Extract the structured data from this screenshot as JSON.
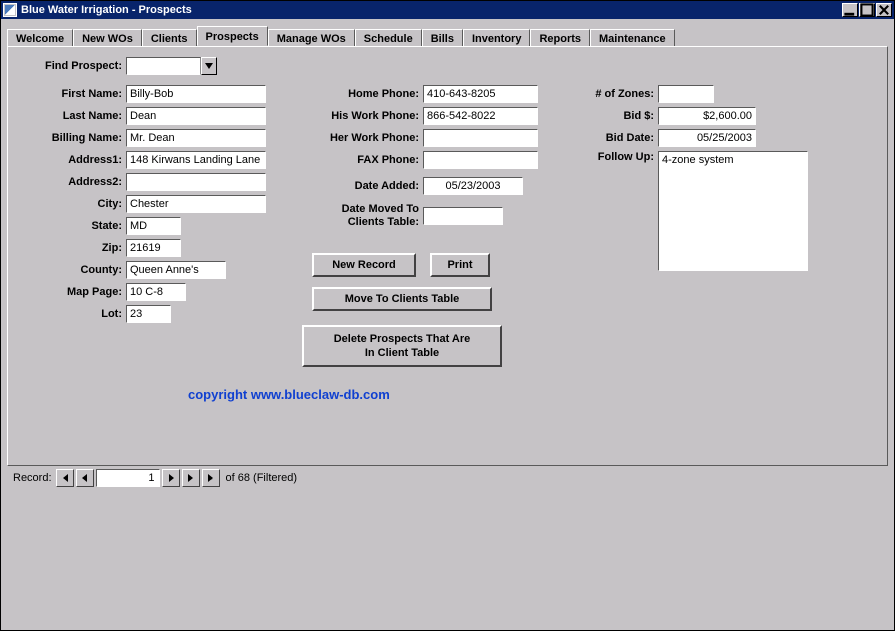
{
  "window": {
    "title": "Blue Water Irrigation - Prospects"
  },
  "tabs": {
    "welcome": "Welcome",
    "new_wos": "New WOs",
    "clients": "Clients",
    "prospects": "Prospects",
    "manage_wos": "Manage WOs",
    "schedule": "Schedule",
    "bills": "Bills",
    "inventory": "Inventory",
    "reports": "Reports",
    "maintenance": "Maintenance"
  },
  "labels": {
    "find_prospect": "Find Prospect:",
    "first_name": "First Name:",
    "last_name": "Last Name:",
    "billing_name": "Billing Name:",
    "address1": "Address1:",
    "address2": "Address2:",
    "city": "City:",
    "state": "State:",
    "zip": "Zip:",
    "county": "County:",
    "map_page": "Map Page:",
    "lot": "Lot:",
    "home_phone": "Home Phone:",
    "his_work_phone": "His Work Phone:",
    "her_work_phone": "Her Work Phone:",
    "fax_phone": "FAX Phone:",
    "date_added": "Date Added:",
    "date_moved": "Date Moved To\nClients Table:",
    "num_zones": "# of Zones:",
    "bid_amount": "Bid $:",
    "bid_date": "Bid Date:",
    "follow_up": "Follow Up:"
  },
  "values": {
    "find_prospect": "",
    "first_name": "Billy-Bob",
    "last_name": "Dean",
    "billing_name": "Mr. Dean",
    "address1": "148 Kirwans Landing Lane",
    "address2": "",
    "city": "Chester",
    "state": "MD",
    "zip": "21619",
    "county": "Queen Anne's",
    "map_page": "10 C-8",
    "lot": "23",
    "home_phone": "410-643-8205",
    "his_work_phone": "866-542-8022",
    "her_work_phone": "",
    "fax_phone": "",
    "date_added": "05/23/2003",
    "date_moved": "",
    "num_zones": "",
    "bid_amount": "$2,600.00",
    "bid_date": "05/25/2003",
    "follow_up": "4-zone system"
  },
  "buttons": {
    "new_record": "New Record",
    "print": "Print",
    "move_to_clients": "Move To Clients Table",
    "delete_in_client": "Delete Prospects That Are\nIn Client Table"
  },
  "copyright": "copyright www.blueclaw-db.com",
  "recordnav": {
    "label": "Record:",
    "current": "1",
    "suffix": "of  68 (Filtered)"
  }
}
